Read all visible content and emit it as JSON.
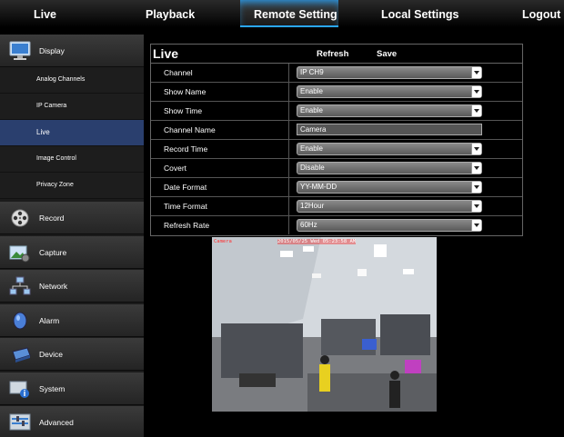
{
  "topnav": {
    "tabs": [
      {
        "label": "Live"
      },
      {
        "label": "Playback"
      },
      {
        "label": "Remote Setting"
      },
      {
        "label": "Local Settings"
      },
      {
        "label": "Logout"
      }
    ],
    "active": "Remote Setting",
    "accent": "#2aa7ff"
  },
  "sidebar": {
    "categories": [
      {
        "label": "Display",
        "icon": "monitor-icon"
      },
      {
        "label": "Record",
        "icon": "film-reel-icon"
      },
      {
        "label": "Capture",
        "icon": "camera-capture-icon"
      },
      {
        "label": "Network",
        "icon": "network-icon"
      },
      {
        "label": "Alarm",
        "icon": "alarm-icon"
      },
      {
        "label": "Device",
        "icon": "hard-drive-icon"
      },
      {
        "label": "System",
        "icon": "system-info-icon"
      },
      {
        "label": "Advanced",
        "icon": "advanced-icon"
      }
    ],
    "display_sub": [
      {
        "label": "Analog Channels"
      },
      {
        "label": "IP Camera"
      },
      {
        "label": "Live"
      },
      {
        "label": "Image Control"
      },
      {
        "label": "Privacy Zone"
      }
    ],
    "selected_sub": "Live",
    "selected_color": "#2a3f6e"
  },
  "form": {
    "title": "Live",
    "refresh_label": "Refresh",
    "save_label": "Save",
    "rows": [
      {
        "name": "Channel",
        "value": "IP CH9",
        "type": "select"
      },
      {
        "name": "Show Name",
        "value": "Enable",
        "type": "select"
      },
      {
        "name": "Show Time",
        "value": "Enable",
        "type": "select"
      },
      {
        "name": "Channel Name",
        "value": "Camera",
        "type": "text"
      },
      {
        "name": "Record Time",
        "value": "Enable",
        "type": "select"
      },
      {
        "name": "Covert",
        "value": "Disable",
        "type": "select"
      },
      {
        "name": "Date Format",
        "value": "YY-MM-DD",
        "type": "select"
      },
      {
        "name": "Time Format",
        "value": "12Hour",
        "type": "select"
      },
      {
        "name": "Refresh Rate",
        "value": "60Hz",
        "type": "select"
      }
    ]
  },
  "preview": {
    "osd_name": "Camera",
    "osd_time": "2015/05/25 Wed 05:23:58 AM"
  }
}
